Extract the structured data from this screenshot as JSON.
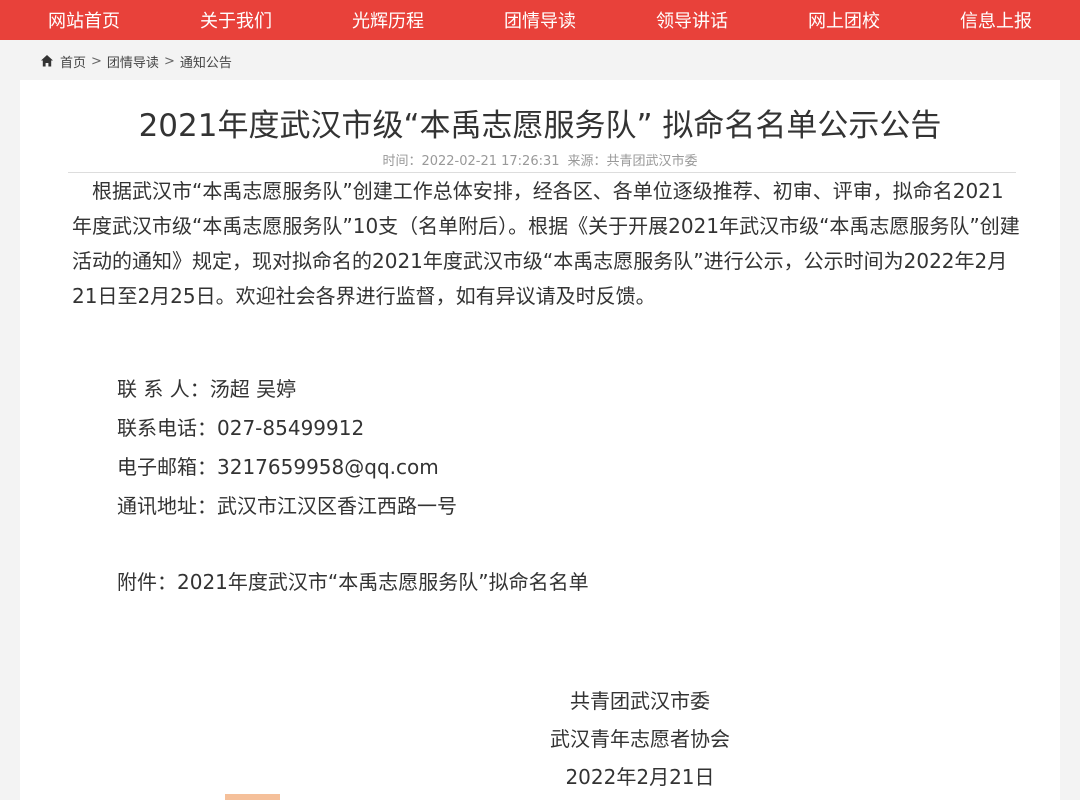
{
  "nav": {
    "items": [
      "网站首页",
      "关于我们",
      "光辉历程",
      "团情导读",
      "领导讲话",
      "网上团校",
      "信息上报"
    ]
  },
  "breadcrumb": {
    "home": "首页",
    "section": "团情导读",
    "current": "通知公告",
    "separator": ">"
  },
  "article": {
    "title": "2021年度武汉市级“本禹志愿服务队” 拟命名名单公示公告",
    "meta_time_label": "时间：",
    "meta_time": "2022-02-21 17:26:31",
    "meta_source_label": "来源：",
    "meta_source": "共青团武汉市委",
    "body": "根据武汉市“本禹志愿服务队”创建工作总体安排，经各区、各单位逐级推荐、初审、评审，拟命名2021年度武汉市级“本禹志愿服务队”10支（名单附后）。根据《关于开展2021年武汉市级“本禹志愿服务队”创建活动的通知》规定，现对拟命名的2021年度武汉市级“本禹志愿服务队”进行公示，公示时间为2022年2月21日至2月25日。欢迎社会各界进行监督，如有异议请及时反馈。",
    "contacts": {
      "person": "联 系 人：汤超 吴婷",
      "phone": "联系电话：027-85499912",
      "email": "电子邮箱：3217659958@qq.com",
      "address": "通讯地址：武汉市江汉区香江西路一号"
    },
    "attachment": "附件：2021年度武汉市“本禹志愿服务队”拟命名名单",
    "signature": [
      "共青团武汉市委",
      "武汉青年志愿者协会",
      "2022年2月21日"
    ]
  },
  "colors": {
    "nav_bg": "#e8413a",
    "page_bg": "#f3f3f3",
    "meta_text": "#999999"
  },
  "icons": {
    "breadcrumb_home": "home-icon"
  }
}
